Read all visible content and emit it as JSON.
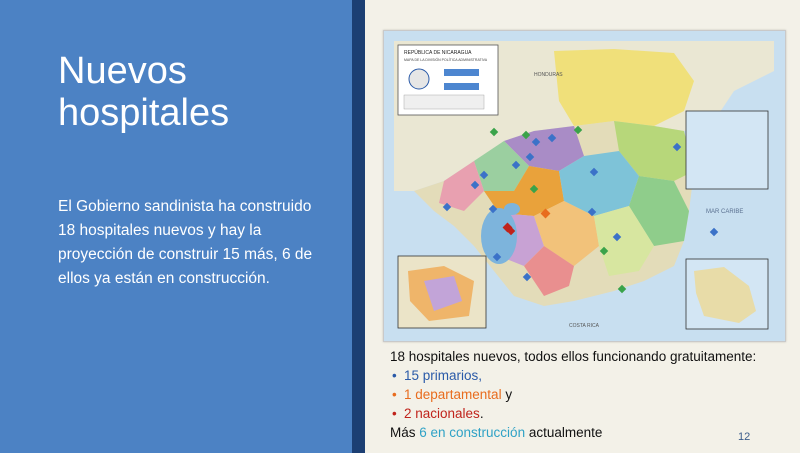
{
  "slide": {
    "title_line1": "Nuevos",
    "title_line2": "hospitales",
    "body": "El Gobierno sandinista ha construido 18 hospitales nuevos y hay la proyección de construir 15 más, 6 de ellos ya están en construcción.",
    "page_number": "12"
  },
  "map": {
    "header_line1": "REPÚBLICA DE NICARAGUA",
    "header_line2": "MAPA DE LA DIVISIÓN POLÍTICA ADMINISTRATIVA",
    "sea_label": "MAR CARIBE",
    "country_label": "COSTA RICA",
    "region_label": "HONDURAS"
  },
  "caption": {
    "intro": "18 hospitales nuevos, todos ellos funcionando gratuitamente:",
    "items": [
      {
        "text": "15 primarios",
        "suffix": ","
      },
      {
        "text": "1 departamental",
        "suffix": " y"
      },
      {
        "text": "2 nacionales",
        "suffix": "."
      }
    ],
    "footer_prefix": "Más ",
    "footer_highlight": "6 en construcción",
    "footer_suffix": " actualmente"
  },
  "colors": {
    "left_panel": "#4c82c4",
    "divider": "#1c3f73",
    "primary_blue": "#2a5aa8",
    "departmental_orange": "#e86c1e",
    "national_red": "#c0231b",
    "construction_teal": "#2fa2c6"
  }
}
